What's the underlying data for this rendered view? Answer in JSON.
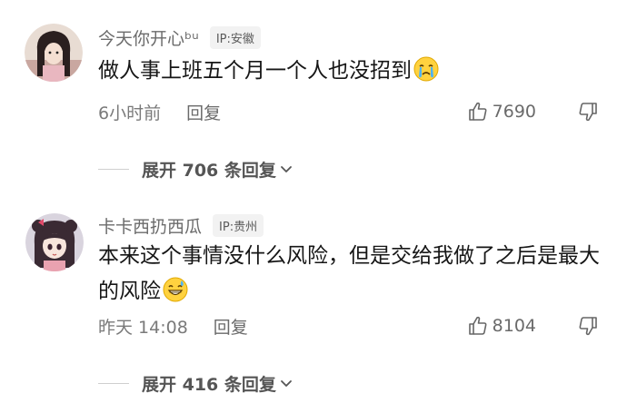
{
  "comments": [
    {
      "username": "今天你开心ᵇᵘ",
      "ip": "IP:安徽",
      "text": "做人事上班五个月一个人也没招到",
      "emoji": "crying-face-emoji",
      "time": "6小时前",
      "reply_label": "回复",
      "likes": "7690",
      "expand_label": "展开 706 条回复"
    },
    {
      "username": "卡卡西扔西瓜",
      "ip": "IP:贵州",
      "text": "本来这个事情没什么风险，但是交给我做了之后是最大的风险",
      "emoji": "grinning-sweat-emoji",
      "time": "昨天 14:08",
      "reply_label": "回复",
      "likes": "8104",
      "expand_label": "展开 416 条回复"
    }
  ],
  "colors": {
    "username": "#6b6b6b",
    "content_text": "#161616",
    "meta_text": "#7a7a7a",
    "badge_bg": "#f2f2f2"
  }
}
